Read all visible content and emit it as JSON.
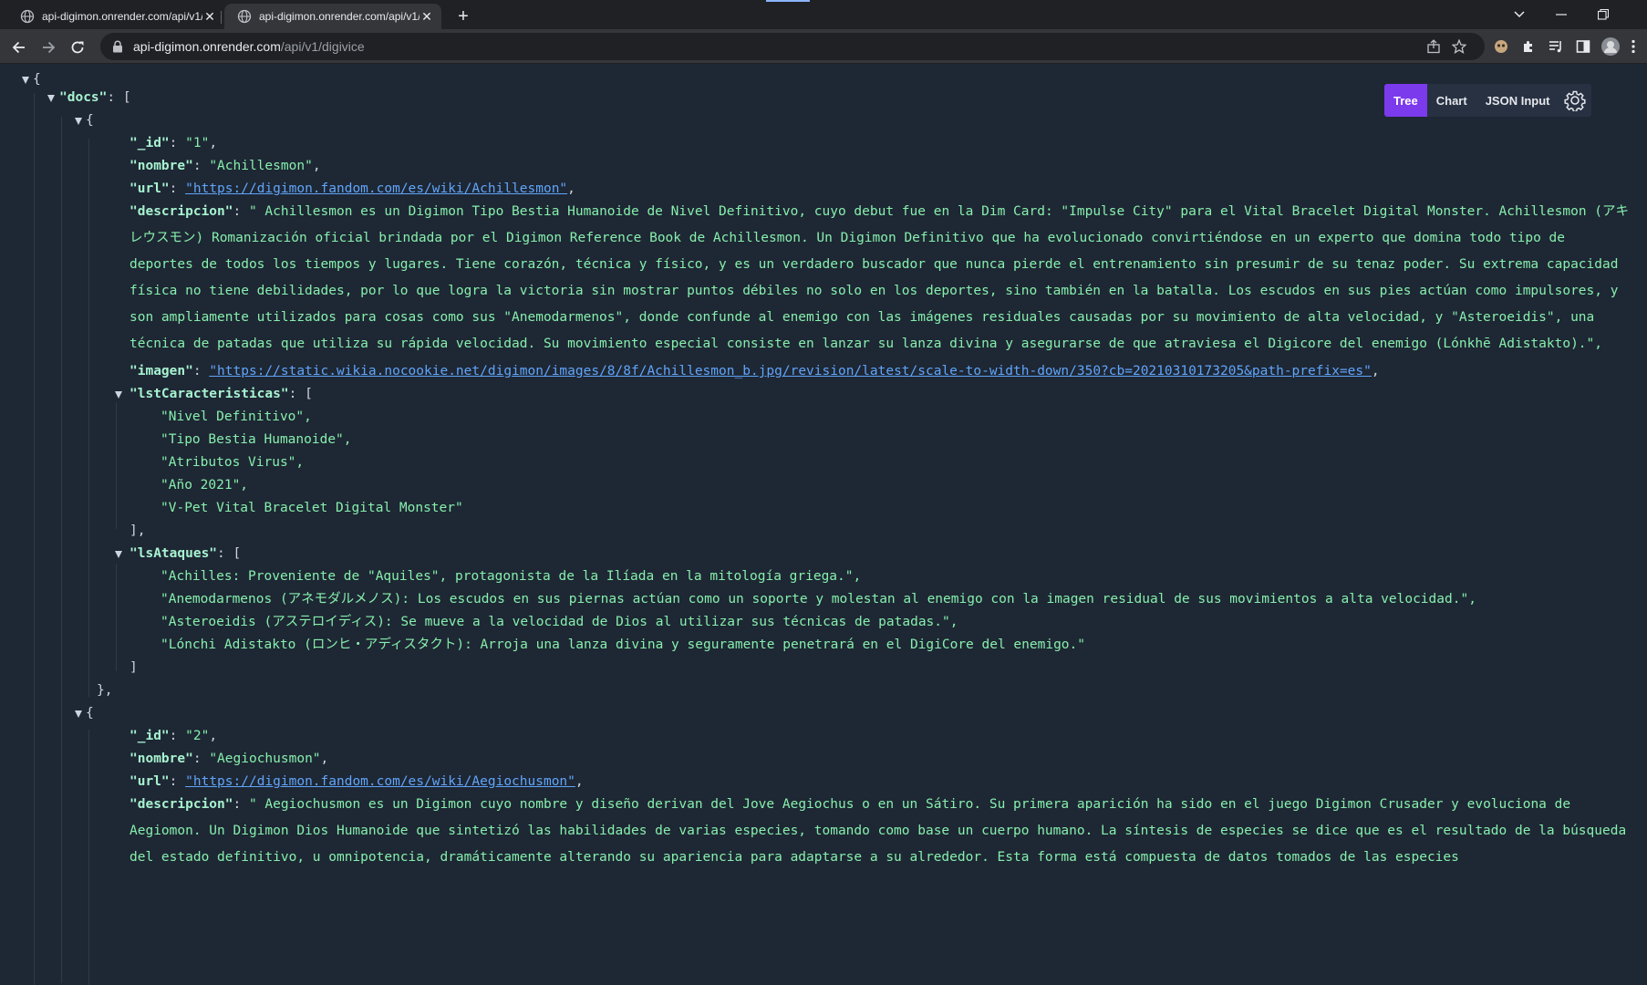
{
  "browser": {
    "tabs": [
      {
        "title": "api-digimon.onrender.com/api/v1/digivice",
        "active": false
      },
      {
        "title": "api-digimon.onrender.com/api/v1/digivice",
        "active": true
      }
    ],
    "url_host": "api-digimon.onrender.com",
    "url_path": "/api/v1/digivice"
  },
  "viewer": {
    "modes": [
      "Tree",
      "Chart",
      "JSON Input"
    ],
    "active_mode": "Tree"
  },
  "json": {
    "root_open": "{",
    "docs_key": "\"docs\"",
    "docs_open": "[",
    "doc1": {
      "open": "{",
      "id_key": "\"_id\"",
      "id_val": "\"1\"",
      "nombre_key": "\"nombre\"",
      "nombre_val": "\"Achillesmon\"",
      "url_key": "\"url\"",
      "url_val": "\"https://digimon.fandom.com/es/wiki/Achillesmon\"",
      "desc_key": "\"descripcion\"",
      "desc_val": "\" Achillesmon es un Digimon Tipo Bestia Humanoide de Nivel Definitivo, cuyo debut fue en la Dim Card: \"Impulse City\" para el Vital Bracelet Digital Monster. Achillesmon (アキレウスモン) Romanización oficial brindada por el Digimon Reference Book de Achillesmon. Un Digimon Definitivo que ha evolucionado convirtiéndose en un experto que domina todo tipo de deportes de todos los tiempos y lugares. Tiene corazón, técnica y físico, y es un verdadero buscador que nunca pierde el entrenamiento sin presumir de su tenaz poder. Su extrema capacidad física no tiene debilidades, por lo que logra la victoria sin mostrar puntos débiles no solo en los deportes, sino también en la batalla. Los escudos en sus pies actúan como impulsores, y son ampliamente utilizados para cosas como sus \"Anemodarmenos\", donde confunde al enemigo con las imágenes residuales causadas por su movimiento de alta velocidad, y \"Asteroeidis\", una técnica de patadas que utiliza su rápida velocidad. Su movimiento especial consiste en lanzar su lanza divina y asegurarse de que atraviesa el Digicore del enemigo (Lónkhē Adistakto).\",",
      "imagen_key": "\"imagen\"",
      "imagen_val": "\"https://static.wikia.nocookie.net/digimon/images/8/8f/Achillesmon_b.jpg/revision/latest/scale-to-width-down/350?cb=20210310173205&path-prefix=es\"",
      "caract_key": "\"lstCaracteristicas\"",
      "caract": [
        "\"Nivel Definitivo\",",
        "\"Tipo Bestia Humanoide\",",
        "\"Atributos Virus\",",
        "\"Año 2021\",",
        "\"V-Pet Vital Bracelet Digital Monster\""
      ],
      "caract_close": "],",
      "ataques_key": "\"lsAtaques\"",
      "ataques": [
        "\"Achilles: Proveniente de \"Aquiles\", protagonista de la Ilíada en la mitología griega.\",",
        "\"Anemodarmenos (アネモダルメノス): Los escudos en sus piernas actúan como un soporte y molestan al enemigo con la imagen residual de sus movimientos a alta velocidad.\",",
        "\"Asteroeidis (アステロイディス): Se mueve a la velocidad de Dios al utilizar sus técnicas de patadas.\",",
        "\"Lónchi Adistakto (ロンヒ・アディスタクト): Arroja una lanza divina y seguramente penetrará en el DigiCore del enemigo.\""
      ],
      "ataques_close": "]",
      "close": "},"
    },
    "doc2": {
      "open": "{",
      "id_key": "\"_id\"",
      "id_val": "\"2\"",
      "nombre_key": "\"nombre\"",
      "nombre_val": "\"Aegiochusmon\"",
      "url_key": "\"url\"",
      "url_val": "\"https://digimon.fandom.com/es/wiki/Aegiochusmon\"",
      "desc_key": "\"descripcion\"",
      "desc_val": "\" Aegiochusmon es un Digimon cuyo nombre y diseño derivan del Jove Aegiochus o en un Sátiro. Su primera aparición ha sido en el juego Digimon Crusader y evoluciona de Aegiomon. Un Digimon Dios Humanoide que sintetizó las habilidades de varias especies, tomando como base un cuerpo humano. La síntesis de especies se dice que es el resultado de la búsqueda del estado definitivo, u omnipotencia, dramáticamente alterando su apariencia para adaptarse a su alrededor. Esta forma está compuesta de datos tomados de las especies"
    }
  }
}
